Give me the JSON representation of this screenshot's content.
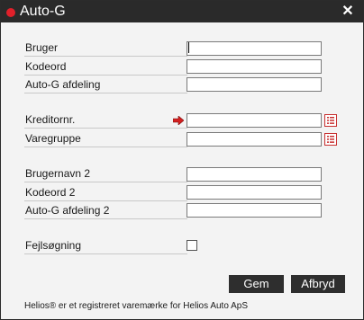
{
  "window": {
    "title": "Auto-G",
    "close_glyph": "✕",
    "accent_color": "#e0202a",
    "titlebar_color": "#2a2a2a"
  },
  "form": {
    "fields": {
      "bruger": {
        "label": "Bruger",
        "value": ""
      },
      "kodeord": {
        "label": "Kodeord",
        "value": ""
      },
      "afdeling": {
        "label": "Auto-G afdeling",
        "value": ""
      },
      "kreditornr": {
        "label": "Kreditornr.",
        "value": ""
      },
      "varegruppe": {
        "label": "Varegruppe",
        "value": ""
      },
      "brugernavn2": {
        "label": "Brugernavn 2",
        "value": ""
      },
      "kodeord2": {
        "label": "Kodeord 2",
        "value": ""
      },
      "afdeling2": {
        "label": "Auto-G afdeling 2",
        "value": ""
      }
    },
    "fejlsoegning": {
      "label": "Fejlsøgning",
      "checked": false
    }
  },
  "buttons": {
    "save": "Gem",
    "cancel": "Afbryd"
  },
  "footer": {
    "text": "Helios® er et registreret varemærke for Helios Auto ApS"
  },
  "icons": {
    "required_marker": "arrow-right-icon",
    "lookup": "list-icon"
  }
}
